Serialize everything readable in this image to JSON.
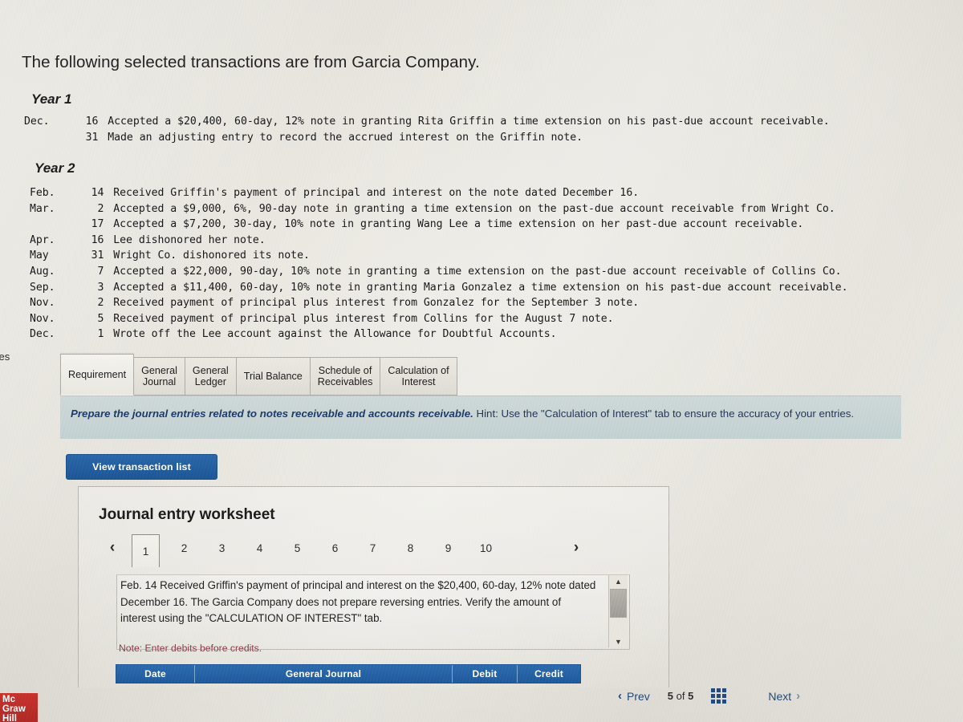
{
  "intro": {
    "statement": "The following selected transactions are from Garcia Company."
  },
  "edge_label": "ces",
  "year1": {
    "heading": "Year 1",
    "transactions": [
      {
        "month": "Dec.",
        "day": "16",
        "text": "Accepted a $20,400, 60-day, 12% note in granting Rita Griffin a time extension on his past-due account receivable."
      },
      {
        "month": "",
        "day": "31",
        "text": "Made an adjusting entry to record the accrued interest on the Griffin note."
      }
    ]
  },
  "year2": {
    "heading": "Year 2",
    "transactions": [
      {
        "month": "Feb.",
        "day": "14",
        "text": "Received Griffin's payment of principal and interest on the note dated December 16."
      },
      {
        "month": "Mar.",
        "day": "2",
        "text": "Accepted a $9,000, 6%, 90-day note in granting a time extension on the past-due account receivable from Wright Co."
      },
      {
        "month": "",
        "day": "17",
        "text": "Accepted a $7,200, 30-day, 10% note in granting Wang Lee a time extension on her past-due account receivable."
      },
      {
        "month": "Apr.",
        "day": "16",
        "text": "Lee dishonored her note."
      },
      {
        "month": "May",
        "day": "31",
        "text": "Wright Co. dishonored its note."
      },
      {
        "month": "Aug.",
        "day": "7",
        "text": "Accepted a $22,000, 90-day, 10% note in granting a time extension on the past-due account receivable of Collins Co."
      },
      {
        "month": "Sep.",
        "day": "3",
        "text": "Accepted a $11,400, 60-day, 10% note in granting Maria Gonzalez a time extension on his past-due account receivable."
      },
      {
        "month": "Nov.",
        "day": "2",
        "text": "Received payment of principal plus interest from Gonzalez for the September 3 note."
      },
      {
        "month": "Nov.",
        "day": "5",
        "text": "Received payment of principal plus interest from Collins for the August 7 note."
      },
      {
        "month": "Dec.",
        "day": "1",
        "text": "Wrote off the Lee account against the Allowance for Doubtful Accounts."
      }
    ]
  },
  "tabs": [
    {
      "label": "Requirement",
      "active": true
    },
    {
      "label": "General\nJournal",
      "active": false
    },
    {
      "label": "General\nLedger",
      "active": false
    },
    {
      "label": "Trial Balance",
      "active": false
    },
    {
      "label": "Schedule of\nReceivables",
      "active": false
    },
    {
      "label": "Calculation of\nInterest",
      "active": false
    }
  ],
  "requirement": {
    "bold_part": "Prepare the journal entries related to notes receivable and accounts receivable.",
    "hint_part": " Hint:  Use the \"Calculation of Interest\" tab to ensure the accuracy of your entries."
  },
  "view_transaction_button": "View transaction list",
  "worksheet": {
    "title": "Journal entry worksheet",
    "pager": {
      "prev_icon": "‹",
      "next_icon": "›",
      "pages": [
        "1",
        "2",
        "3",
        "4",
        "5",
        "6",
        "7",
        "8",
        "9",
        "10"
      ],
      "active_page": "1"
    },
    "entry_description": "Feb. 14 Received Griffin's payment of principal and interest on the $20,400, 60-day, 12% note dated December 16. The Garcia Company does not prepare reversing entries. Verify the amount of interest using the \"CALCULATION OF INTEREST\" tab.",
    "scrollbar": {
      "up_icon": "▲",
      "down_icon": "▼"
    },
    "note": "Note: Enter debits before credits.",
    "table_headers": [
      "Date",
      "General Journal",
      "Debit",
      "Credit"
    ]
  },
  "bottom_nav": {
    "prev_label": "Prev",
    "prev_icon": "‹",
    "page_indicator_current": "5",
    "page_indicator_of": "of",
    "page_indicator_total": "5",
    "grid_icon": "grid-icon",
    "next_label": "Next",
    "next_icon": "›"
  },
  "branding": {
    "line1": "Mc",
    "line2": "Graw",
    "line3": "Hill"
  },
  "colors": {
    "accent_blue": "#1f5a9b",
    "banner": "#c7d2d3",
    "link": "#214a7c",
    "note_red": "#8c3a4a",
    "logo_red": "#c7322c"
  }
}
